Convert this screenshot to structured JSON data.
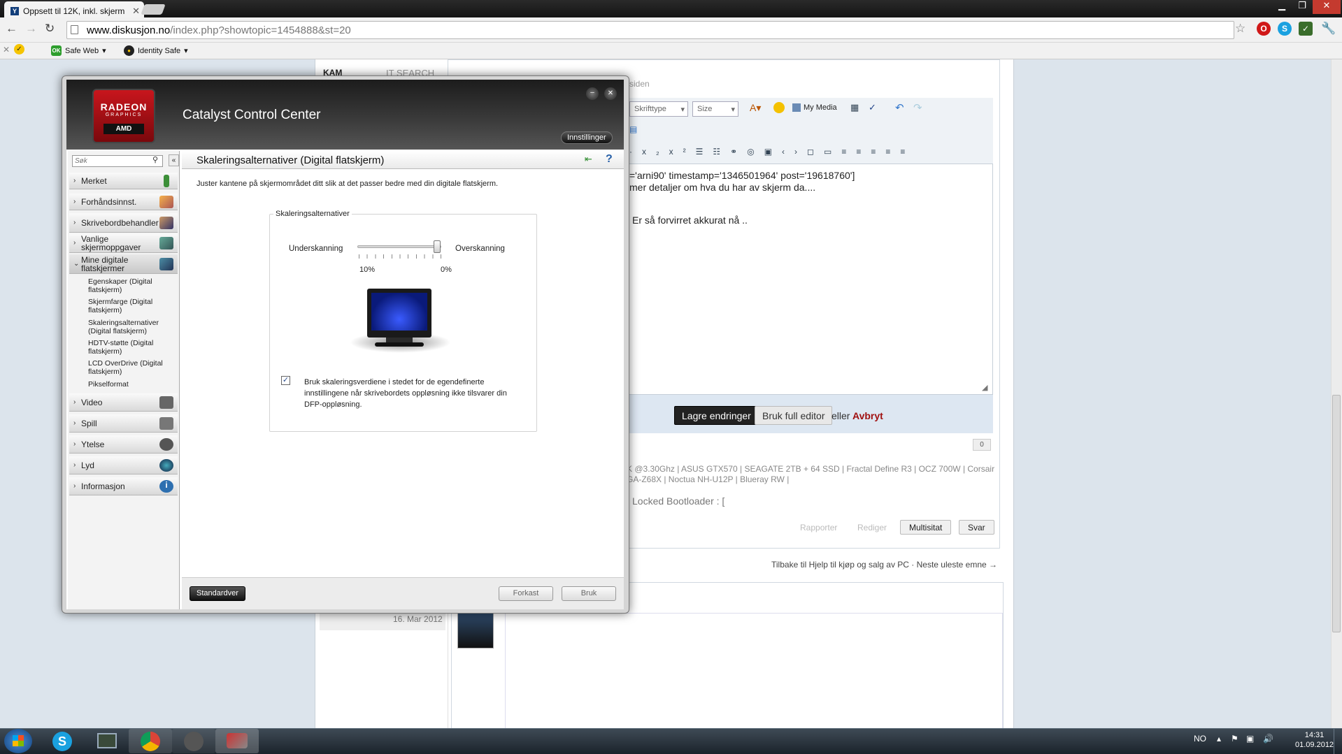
{
  "browser": {
    "tab_title": "Oppsett til 12K, inkl. skjerm",
    "url_domain": "www.diskusjon.no",
    "url_path": "/index.php?showtopic=1454888&st=20",
    "bookmarks": [
      {
        "label": "Safe Web",
        "icon": "norton-safe-web-icon"
      },
      {
        "label": "Identity Safe",
        "icon": "norton-identity-safe-icon"
      }
    ]
  },
  "webpage": {
    "kam_label": "KAM",
    "it_search_label": "IT SEARCH",
    "siden_label": "siden",
    "font_select": "Skrifttype",
    "size_select": "Size",
    "my_media": "My Media",
    "editor_lines": [
      "='arni90' timestamp='1346501964' post='19618760']",
      "mer detaljer om hva du har av skjerm da....",
      "Er så forvirret akkurat nå .."
    ],
    "save_button": "Lagre endringer",
    "full_editor_button": "Bruk full editor",
    "or_text": "eller",
    "cancel_link": "Avbryt",
    "rep_count": "0",
    "signature_line1": "K @3.30Ghz | ASUS GTX570 | SEAGATE 2TB + 64 SSD | Fractal Define R3 | OCZ 700W | Corsair",
    "signature_line2": "GA-Z68X | Noctua NH-U12P | Blueray RW |",
    "locked_text": "Locked Bootloader : [",
    "report_link": "Rapporter",
    "edit_link": "Rediger",
    "multiquote_button": "Multisitat",
    "reply_button": "Svar",
    "footer_nav": "Tilbake til Hjelp til kjøp og salg av PC · Neste uleste emne →",
    "post_date": "16. Mar 2012"
  },
  "ccc": {
    "app_title": "Catalyst Control Center",
    "logo_line1": "RADEON",
    "logo_line2": "GRAPHICS",
    "logo_line3": "AMD",
    "settings_button": "Innstillinger",
    "search_placeholder": "Søk",
    "sidebar_items": [
      {
        "label": "Merket"
      },
      {
        "label": "Forhåndsinnst."
      },
      {
        "label": "Skrivebordbehandler"
      },
      {
        "label": "Vanlige skjermoppgaver"
      },
      {
        "label": "Mine digitale flatskjermer"
      }
    ],
    "sidebar_subitems": [
      "Egenskaper (Digital flatskjerm)",
      "Skjermfarge (Digital flatskjerm)",
      "Skaleringsalternativer (Digital flatskjerm)",
      "HDTV-støtte (Digital flatskjerm)",
      "LCD OverDrive (Digital flatskjerm)",
      "Pikselformat"
    ],
    "sidebar_bottom_items": [
      {
        "label": "Video"
      },
      {
        "label": "Spill"
      },
      {
        "label": "Ytelse"
      },
      {
        "label": "Lyd"
      },
      {
        "label": "Informasjon"
      }
    ],
    "panel_title": "Skaleringsalternativer (Digital flatskjerm)",
    "panel_description": "Juster kantene på skjermområdet ditt slik at det passer bedre med din digitale flatskjerm.",
    "group_title": "Skaleringsalternativer",
    "slider_left_label": "Underskanning",
    "slider_right_label": "Overskanning",
    "slider_min_value": "10%",
    "slider_max_value": "0%",
    "slider_position": 1.0,
    "checkbox_checked": true,
    "checkbox_label": "Bruk skaleringsverdiene i stedet for de egendefinerte innstillingene når skrivebordets oppløsning ikke tilsvarer din DFP-oppløsning.",
    "defaults_button": "Standardver",
    "discard_button": "Forkast",
    "apply_button": "Bruk"
  },
  "taskbar": {
    "language": "NO",
    "time": "14:31",
    "date": "01.09.2012"
  }
}
